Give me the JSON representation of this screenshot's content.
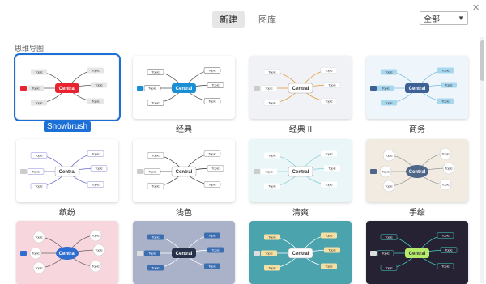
{
  "tabs": [
    {
      "label": "新建",
      "active": true
    },
    {
      "label": "图库",
      "active": false
    }
  ],
  "filter": {
    "selected": "全部"
  },
  "section_title": "思维导图",
  "templates": [
    {
      "label": "Snowbrush",
      "selected": true,
      "bg": "#ffffff",
      "center": "Central"
    },
    {
      "label": "经典",
      "selected": false,
      "bg": "#ffffff",
      "center": "Central"
    },
    {
      "label": "经典 II",
      "selected": false,
      "bg": "#f1f2f6",
      "center": "Central"
    },
    {
      "label": "商务",
      "selected": false,
      "bg": "#eef6fb",
      "center": "Central"
    },
    {
      "label": "缤纷",
      "selected": false,
      "bg": "#ffffff",
      "center": "Central"
    },
    {
      "label": "浅色",
      "selected": false,
      "bg": "#ffffff",
      "center": "Central"
    },
    {
      "label": "清爽",
      "selected": false,
      "bg": "#eaf6f8",
      "center": "Central"
    },
    {
      "label": "手绘",
      "selected": false,
      "bg": "#f1ebe2",
      "center": "Central"
    },
    {
      "label": "",
      "selected": false,
      "bg": "#f8d6de",
      "center": "Central"
    },
    {
      "label": "",
      "selected": false,
      "bg": "#aab2c9",
      "center": "Central"
    },
    {
      "label": "",
      "selected": false,
      "bg": "#4aa3ad",
      "center": "Central"
    },
    {
      "label": "",
      "selected": false,
      "bg": "#262233",
      "center": "Central"
    }
  ],
  "topic_text": "Topic",
  "close_icon": "close-icon",
  "colors": {
    "accent": "#1d6fd8"
  }
}
